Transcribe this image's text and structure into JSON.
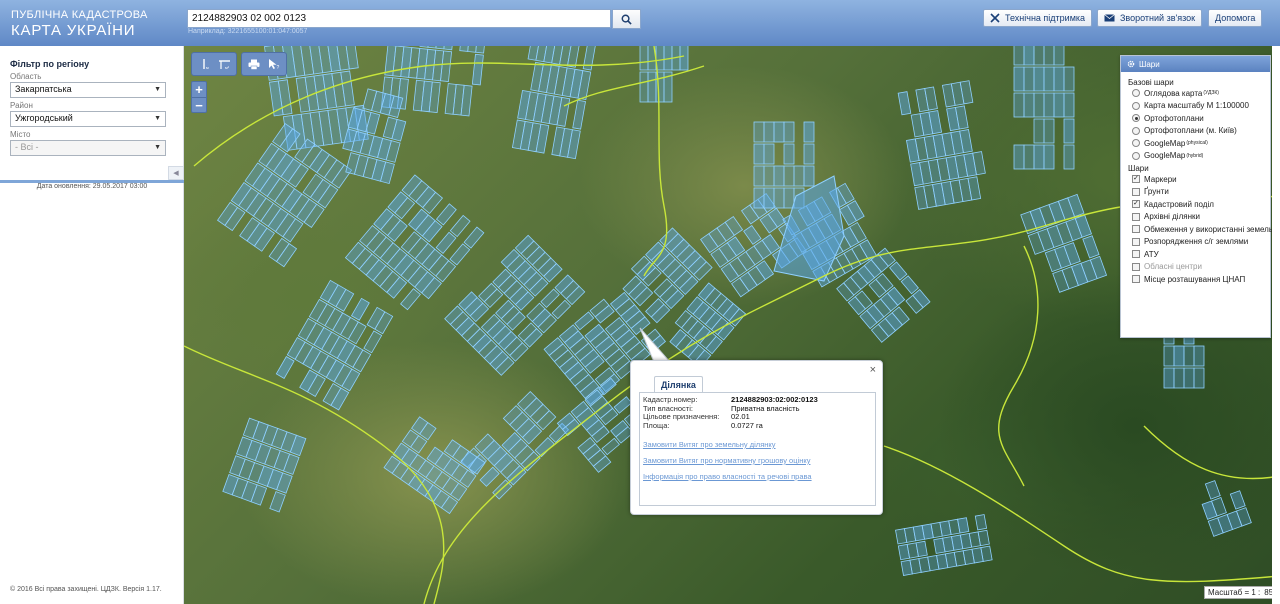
{
  "header": {
    "logo_top": "ПУБЛІЧНА КАДАСТРОВА",
    "logo_main": "КАРТА УКРАЇНИ",
    "search_value": "2124882903 02 002 0123",
    "search_hint": "Наприклад: 3221655100:01:047:0057",
    "buttons": {
      "support": "Технічна підтримка",
      "feedback": "Зворотний зв'язок",
      "help": "Допомога"
    }
  },
  "sidebar": {
    "filter_title": "Фільтр по регіону",
    "region_label": "Область",
    "region_value": "Закарпатська",
    "district_label": "Район",
    "district_value": "Ужгородський",
    "city_label": "Місто",
    "city_value": "- Всі -",
    "update_date": "Дата оновлення: 29.05.2017 03:00",
    "copyright": "© 2016 Всі права захищені. ЦДЗК. Версія 1.17."
  },
  "layers": {
    "title": "Шари",
    "base_title": "Базові шари",
    "base": [
      {
        "label": "Оглядова карта",
        "sup": "(УДЗК)",
        "on": false
      },
      {
        "label": "Карта масштабу М 1:100000",
        "sup": "",
        "on": false
      },
      {
        "label": "Ортофотоплани",
        "sup": "",
        "on": true
      },
      {
        "label": "Ортофотоплани (м. Київ)",
        "sup": "",
        "on": false
      },
      {
        "label": "GoogleMap",
        "sup": "(physical)",
        "on": false
      },
      {
        "label": "GoogleMap",
        "sup": "(hybrid)",
        "on": false
      }
    ],
    "overlay_title": "Шари",
    "overlays": [
      {
        "label": "Маркери",
        "checked": true,
        "dim": false
      },
      {
        "label": "Ґрунти",
        "checked": false,
        "dim": false
      },
      {
        "label": "Кадастровий поділ",
        "checked": true,
        "dim": false
      },
      {
        "label": "Архівні ділянки",
        "checked": false,
        "dim": false
      },
      {
        "label": "Обмеження у використанні земель",
        "checked": false,
        "dim": false
      },
      {
        "label": "Розпорядження с/г землями",
        "checked": false,
        "dim": false
      },
      {
        "label": "АТУ",
        "checked": false,
        "dim": false
      },
      {
        "label": "Обласні центри",
        "checked": false,
        "dim": true
      },
      {
        "label": "Місце розташування ЦНАП",
        "checked": false,
        "dim": false
      }
    ]
  },
  "popup": {
    "tab": "Ділянка",
    "rows": [
      {
        "k": "Кадастр.номер:",
        "v": "2124882903:02:002:0123",
        "bold": true
      },
      {
        "k": "Тип власності:",
        "v": "Приватна власність",
        "bold": false
      },
      {
        "k": "Цільове призначення:",
        "v": "02.01",
        "bold": false
      },
      {
        "k": "Площа:",
        "v": "0.0727 га",
        "bold": false
      }
    ],
    "links": [
      "Замовити Витяг про земельну ділянку",
      "Замовити Витяг про нормативну грошову оцінку",
      "Інформація про право власності та речові права"
    ],
    "close": "×"
  },
  "scale": {
    "label": "Масштаб = 1 :",
    "value": "8531"
  },
  "colors": {
    "accent": "#5f88c6",
    "parcel_stroke": "#8fd0ff",
    "parcel_fill": "#5aa8e8",
    "boundary": "#c8e63a"
  }
}
